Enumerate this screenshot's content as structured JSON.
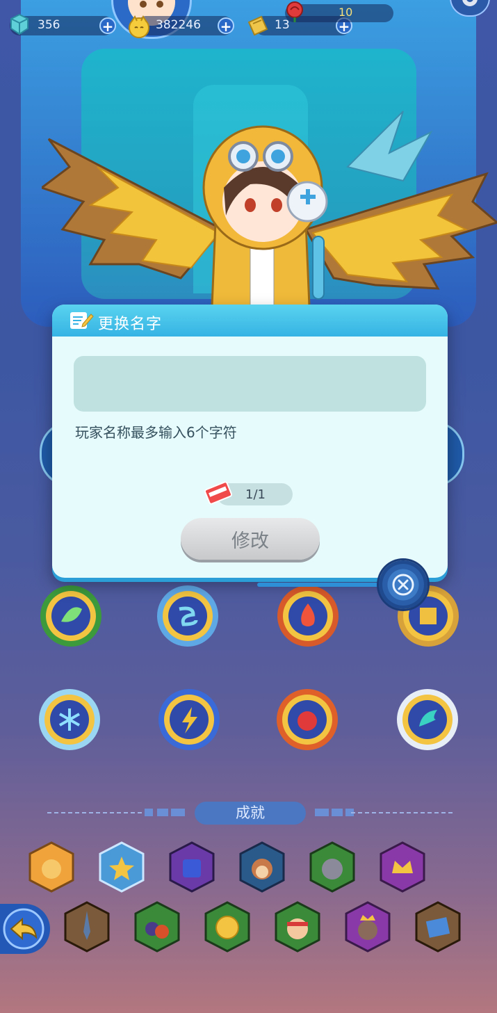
{
  "top_bar": {
    "gems": "356",
    "coins": "382246",
    "tickets": "13",
    "roses": "10",
    "icons": [
      "gem-icon",
      "cat-coin-icon",
      "ticket-icon",
      "rose-icon",
      "settings-icon"
    ]
  },
  "rename_dialog": {
    "title": "更换名字",
    "input_value": "",
    "input_placeholder": "",
    "hint": "玩家名称最多输入6个字符",
    "cost": "1/1",
    "modify_button": "修改"
  },
  "sections": {
    "achievements_label": "成就"
  },
  "badges": {
    "elements": [
      "leaf",
      "wind",
      "fire",
      "earth",
      "ice",
      "lightning",
      "beast",
      "wing"
    ]
  },
  "colors": {
    "bg_top": "#3f57a6",
    "bg_bottom": "#b3777f",
    "dialog_header": "#35b3e4",
    "dialog_body": "#e6fbfb",
    "button_disabled": "#c7c9cb"
  }
}
